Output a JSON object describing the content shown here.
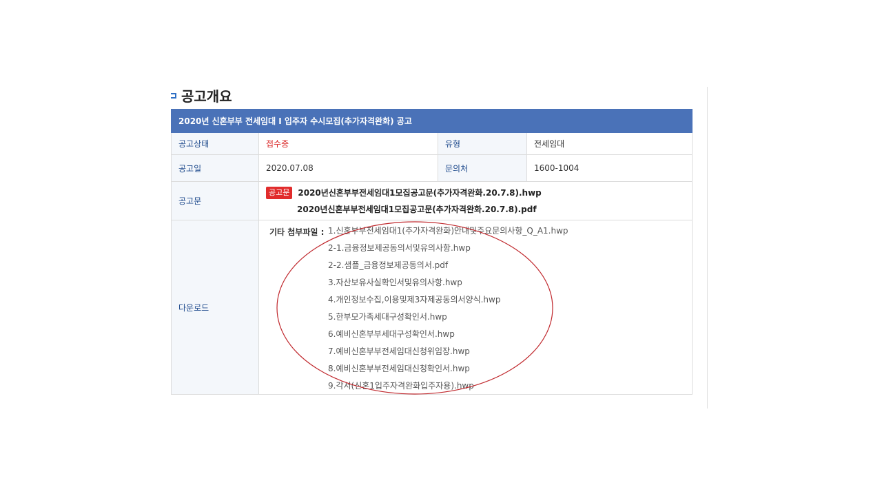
{
  "section": {
    "title": "공고개요"
  },
  "notice": {
    "title": "2020년 신혼부부 전세임대 I 입주자 수시모집(추가자격완화) 공고",
    "rows": {
      "status_label": "공고상태",
      "status_value": "접수중",
      "type_label": "유형",
      "type_value": "전세임대",
      "date_label": "공고일",
      "date_value": "2020.07.08",
      "contact_label": "문의처",
      "contact_value": "1600-1004",
      "doc_label": "공고문",
      "doc_badge": "공고문",
      "doc_files": [
        "2020년신혼부부전세임대1모집공고문(추가자격완화.20.7.8).hwp",
        "2020년신혼부부전세임대1모집공고문(추가자격완화.20.7.8).pdf"
      ],
      "download_label": "다운로드",
      "other_attach_label": "기타 첨부파일 :",
      "download_files": [
        "1.신혼부부전세임대1(추가자격완화)안내및주요문의사항_Q_A1.hwp",
        "2-1.금융정보제공동의서및유의사항.hwp",
        "2-2.샘플_금융정보제공동의서.pdf",
        "3.자산보유사실확인서및유의사항.hwp",
        "4.개인정보수집,이용및제3자제공동의서양식.hwp",
        "5.한부모가족세대구성확인서.hwp",
        "6.예비신혼부부세대구성확인서.hwp",
        "7.예비신혼부부전세임대신청위임장.hwp",
        "8.예비신혼부부전세임대신청확인서.hwp",
        "9.각서(신혼1입주자격완화입주자용).hwp"
      ]
    }
  },
  "colors": {
    "header_bg": "#4a72b8",
    "label_text": "#1e4a8c",
    "status_red": "#d92424",
    "badge_red": "#e12c2c",
    "annotation_circle": "#c0282d"
  }
}
